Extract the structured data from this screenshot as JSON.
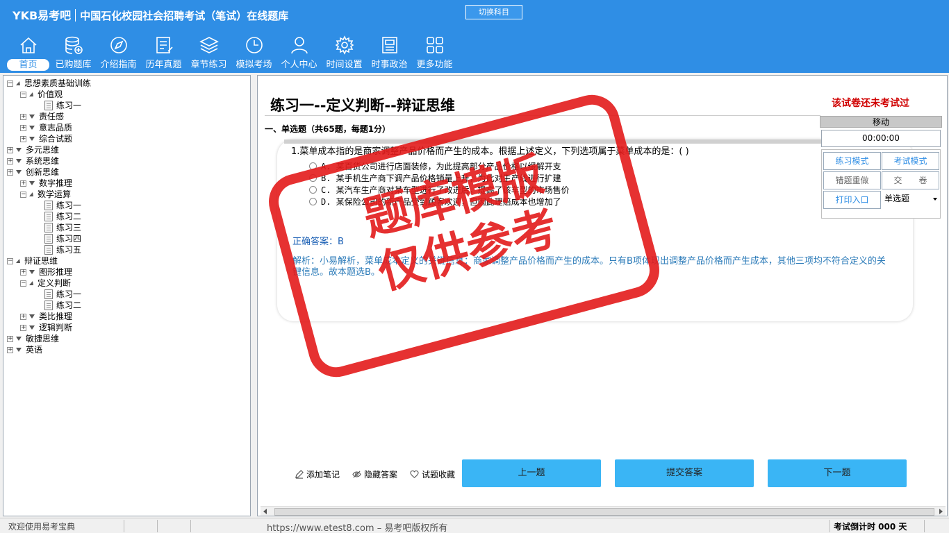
{
  "header": {
    "brand_logo": "YKB易考吧",
    "brand_title": "中国石化校园社会招聘考试（笔试）在线题库",
    "switch_label": "切换科目"
  },
  "nav": [
    {
      "label": "首页",
      "icon": "home-icon"
    },
    {
      "label": "已购题库",
      "icon": "database-icon"
    },
    {
      "label": "介绍指南",
      "icon": "compass-icon"
    },
    {
      "label": "历年真题",
      "icon": "list-icon"
    },
    {
      "label": "章节练习",
      "icon": "layers-icon"
    },
    {
      "label": "模拟考场",
      "icon": "clock-icon"
    },
    {
      "label": "个人中心",
      "icon": "user-icon"
    },
    {
      "label": "时间设置",
      "icon": "gear-icon"
    },
    {
      "label": "时事政治",
      "icon": "news-icon"
    },
    {
      "label": "更多功能",
      "icon": "grid-icon"
    }
  ],
  "tree": [
    {
      "label": "思想素质基础训练",
      "level": 0,
      "type": "open"
    },
    {
      "label": "价值观",
      "level": 1,
      "type": "open"
    },
    {
      "label": "练习一",
      "level": 2,
      "type": "doc"
    },
    {
      "label": "责任感",
      "level": 1,
      "type": "closed"
    },
    {
      "label": "意志品质",
      "level": 1,
      "type": "closed"
    },
    {
      "label": "综合试题",
      "level": 1,
      "type": "closed"
    },
    {
      "label": "多元思维",
      "level": 0,
      "type": "closed"
    },
    {
      "label": "系统思维",
      "level": 0,
      "type": "closed"
    },
    {
      "label": "创新思维",
      "level": 0,
      "type": "closed"
    },
    {
      "label": "数字推理",
      "level": 1,
      "type": "closed"
    },
    {
      "label": "数学运算",
      "level": 1,
      "type": "open"
    },
    {
      "label": "练习一",
      "level": 2,
      "type": "doc"
    },
    {
      "label": "练习二",
      "level": 2,
      "type": "doc"
    },
    {
      "label": "练习三",
      "level": 2,
      "type": "doc"
    },
    {
      "label": "练习四",
      "level": 2,
      "type": "doc"
    },
    {
      "label": "练习五",
      "level": 2,
      "type": "doc"
    },
    {
      "label": "辩证思维",
      "level": 0,
      "type": "open"
    },
    {
      "label": "图形推理",
      "level": 1,
      "type": "closed"
    },
    {
      "label": "定义判断",
      "level": 1,
      "type": "open"
    },
    {
      "label": "练习一",
      "level": 2,
      "type": "doc"
    },
    {
      "label": "练习二",
      "level": 2,
      "type": "doc"
    },
    {
      "label": "类比推理",
      "level": 1,
      "type": "closed"
    },
    {
      "label": "逻辑判断",
      "level": 1,
      "type": "closed"
    },
    {
      "label": "敏捷思维",
      "level": 0,
      "type": "closed"
    },
    {
      "label": "英语",
      "level": 0,
      "type": "closed"
    }
  ],
  "paper": {
    "title": "练习一--定义判断--辩证思维",
    "status": "该试卷还未考试过",
    "section": "一、单选题（共65题，每题1分）"
  },
  "question": {
    "text": "1.菜单成本指的是商家调整产品价格而产生的成本。根据上述定义，下列选项属于菜单成本的是：( )",
    "options": [
      "A. 某百货公司进行店面装修，为此提高部分产品价格以缓解开支",
      "B. 某手机生产商下调产品价格销量上升，为此对生产线进行扩建",
      "C. 某汽车生产商对某车型进行了改进后，提高了该车型的市场售价",
      "D. 某保险公司的新产品受到顾客欢迎，但因此理赔成本也增加了"
    ],
    "answer": "正确答案：B",
    "analysis": "解析：小易解析，菜单成本定义的关键信息：商家调整产品价格而产生的成本。只有B项体现出调整产品价格而产生成本，其他三项均不符合定义的关键信息。故本题选B。"
  },
  "stamp": {
    "line1": "题库模版",
    "line2": "仅供参考"
  },
  "side": {
    "move": "移动",
    "timer": "00:00:00",
    "practice_mode": "练习模式",
    "exam_mode": "考试模式",
    "redo_wrong": "错题重做",
    "submit_paper": "交　　卷",
    "print": "打印入口",
    "type_select": "单选题"
  },
  "tools": {
    "note": "添加笔记",
    "hide_answer": "隐藏答案",
    "favorite": "试题收藏"
  },
  "buttons": {
    "prev": "上一题",
    "submit": "提交答案",
    "next": "下一题"
  },
  "status": {
    "welcome": "欢迎使用易考宝典",
    "url": "https://www.etest8.com – 易考吧版权所有",
    "countdown": "考试倒计时 000 天"
  }
}
